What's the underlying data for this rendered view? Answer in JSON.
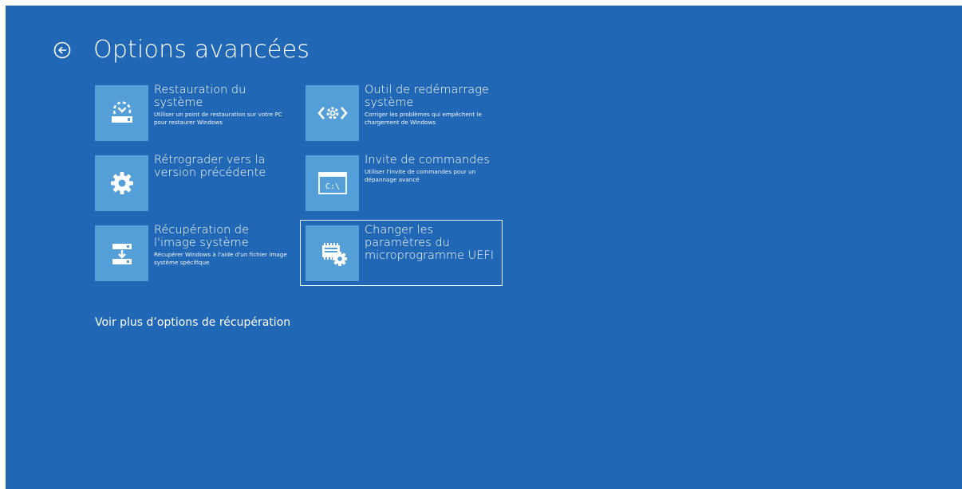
{
  "header": {
    "title": "Options avancées",
    "back_icon": "back-arrow-circle-icon"
  },
  "tiles": [
    {
      "title": "Restauration du système",
      "description": "Utiliser un point de restauration sur votre PC pour restaurer Windows",
      "icon": "system-restore-icon"
    },
    {
      "title": "Outil de redémarrage système",
      "description": "Corriger les problèmes qui empêchent le chargement de Windows",
      "icon": "startup-repair-icon"
    },
    {
      "title": "Rétrograder vers la version précédente",
      "description": "",
      "icon": "gear-icon"
    },
    {
      "title": "Invite de commandes",
      "description": "Utiliser l'invite de commandes pour un dépannage avancé",
      "icon": "command-prompt-icon",
      "icon_text": "C:\\"
    },
    {
      "title": "Récupération de l'image système",
      "description": "Récupérer Windows à l'aide d'un fichier image système spécifique",
      "icon": "system-image-recovery-icon"
    },
    {
      "title": "Changer les paramètres du microprogramme UEFI",
      "description": "",
      "icon": "uefi-firmware-settings-icon",
      "selected": true
    }
  ],
  "more_options_link": "Voir plus d’options de récupération",
  "colors": {
    "background": "#2067b5",
    "tile_icon": "#559fd9",
    "text": "#ffffff"
  }
}
